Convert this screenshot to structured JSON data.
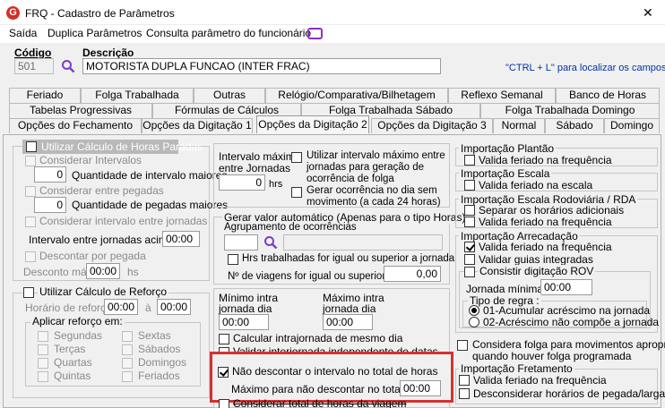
{
  "window": {
    "title": "FRQ - Cadastro de Parâmetros",
    "icon": "app-g-icon",
    "close_glyph": "✕"
  },
  "menu": {
    "items": [
      "Saída",
      "Duplica Parâmetros",
      "Consulta parâmetro do funcionário"
    ]
  },
  "header": {
    "codigo_label": "Código",
    "codigo_value": "501",
    "descricao_label": "Descrição",
    "descricao_value": "MOTORISTA DUPLA FUNCAO (INTER FRAC)",
    "hint": "\"CTRL + L\" para localizar os campos"
  },
  "tabs": {
    "row1": [
      "Feriado",
      "Folga Trabalhada",
      "Outras",
      "Relógio/Comparativa/Bilhetagem",
      "Reflexo Semanal",
      "Banco de Horas"
    ],
    "row2": [
      "Tabelas Progressivas",
      "Fórmulas de Cálculos",
      "Folga Trabalhada Sábado",
      "Folga Trabalhada Domingo"
    ],
    "row3": [
      "Opções do Fechamento",
      "Opções da Digitação 1",
      "Opções da Digitação 2",
      "Opções da Digitação 3",
      "Normal",
      "Sábado",
      "Domingo"
    ]
  },
  "horas_paradas": {
    "title": "Utilizar Cálculo de Horas Paradas",
    "considerar_intervalos": "Considerar Intervalos",
    "qtd_intervalo_value": "0",
    "qtd_intervalo_label": "Quantidade de intervalo maiores",
    "considerar_pegadas": "Considerar entre pegadas",
    "qtd_pegadas_value": "0",
    "qtd_pegadas_label": "Quantidade de pegadas maiores",
    "considerar_intervalo_jornadas": "Considerar intervalo entre jornadas",
    "intervalo_jornadas_label": "Intervalo entre jornadas acima de",
    "intervalo_jornadas_value": "00:00",
    "descontar_pegada": "Descontar por pegada",
    "desconto_max_label": "Desconto máx",
    "desconto_max_value": "00:00",
    "desconto_max_unit": "hs"
  },
  "reforco": {
    "title": "Utilizar Cálculo de Reforço",
    "horario_label": "Horário de reforço",
    "horario_de": "00:00",
    "horario_a_label": "à",
    "horario_a": "00:00",
    "aplicar_title": "Aplicar reforço em:",
    "days": [
      "Segundas",
      "Terças",
      "Quartas",
      "Quintas",
      "Sextas",
      "Sábados",
      "Domingos",
      "Feriados"
    ]
  },
  "intervalo": {
    "max_label_1": "Intervalo máximo",
    "max_label_2": "entre Jornadas",
    "max_value": "0",
    "max_unit": "hrs",
    "utilizar_label_1": "Utilizar intervalo máximo entre",
    "utilizar_label_2": "jornadas para geração de",
    "utilizar_label_3": "ocorrência de folga",
    "gerar_label_1": "Gerar ocorrência no dia sem",
    "gerar_label_2": "movimento (a cada 24 horas)"
  },
  "gerar_valor": {
    "title": "Gerar valor automático (Apenas para o tipo Horas)",
    "agrupamento_label": "Agrupamento de ocorrências",
    "hrs_label": "Hrs trabalhadas for igual ou superior a jornada",
    "viagens_label": "Nº de viagens for igual ou superior a",
    "viagens_value": "0,00"
  },
  "intrajornada": {
    "minimo_label_1": "Mínimo intra",
    "minimo_label_2": "jornada dia",
    "minimo_value": "00:00",
    "maximo_label_1": "Máximo intra",
    "maximo_label_2": "jornada dia",
    "maximo_value": "00:00",
    "calcular_label": "Calcular intrajornada de mesmo dia",
    "validar_label": "Validar interjornada independente de datas",
    "nao_descontar_label": "Não descontar o intervalo no total de horas",
    "maximo_desc_label": "Máximo para não descontar no total de hrs",
    "maximo_desc_value": "00:00",
    "considerar_viagem_label": "Considerar total de horas da viagem"
  },
  "plantao": {
    "title": "Importação Plantão",
    "valida_label": "Valida feriado na frequência"
  },
  "escala": {
    "title": "Importação Escala",
    "valida_label": "Valida feriado na escala"
  },
  "rodoviaria": {
    "title": "Importação Escala Rodoviária / RDA",
    "separar_label": "Separar os horários adicionais",
    "valida_label": "Valida feriado na frequência"
  },
  "arrecadacao": {
    "title": "Importação Arrecadação",
    "valida_label": "Valida feriado na frequência",
    "validar_guias_label": "Validar guias integradas",
    "consistir_label": "Consistir digitação ROV",
    "jornada_label": "Jornada mínima",
    "jornada_value": "00:00",
    "tipo_regra_label": "Tipo de regra :",
    "regra1": "01-Acumular acréscimo na jornada",
    "regra2": "02-Acréscimo não compõe a jornada"
  },
  "folga": {
    "label_1": "Considera folga para movimentos apropria 1",
    "label_2": "quando houver folga programada"
  },
  "fretamento": {
    "title": "Importação Fretamento",
    "valida_label": "Valida feriado na frequência",
    "desconsiderar_label": "Desconsiderar horários de pegada/largada"
  },
  "colors": {
    "accent": "#d22f27",
    "highlight_box": "#d43232",
    "hint_blue": "#0033aa",
    "chat_icon": "#8b2fc9"
  }
}
